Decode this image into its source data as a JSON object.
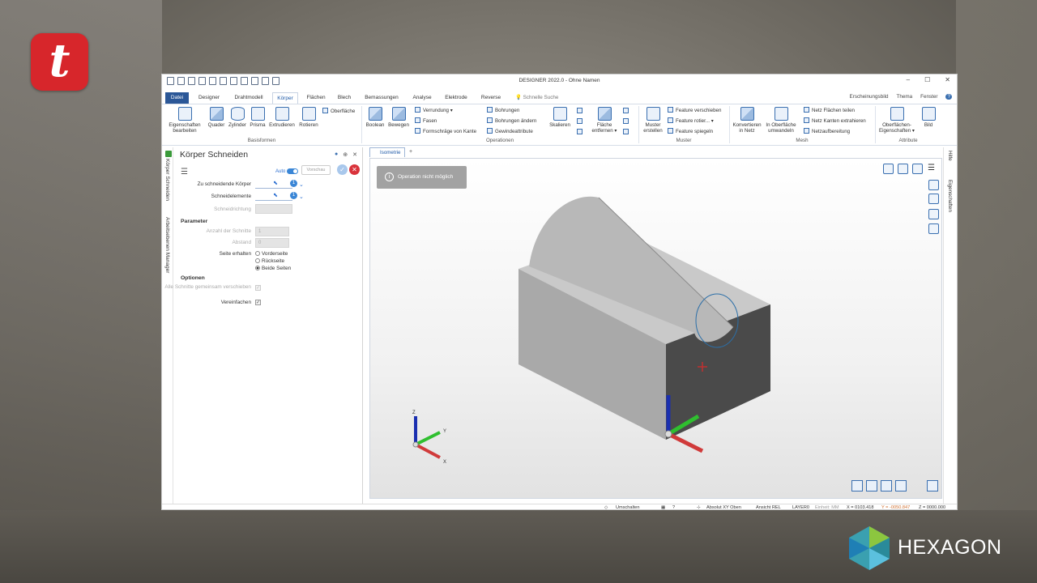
{
  "brand": {
    "corner_logo_letter": "t",
    "vendor_name": "HEXAGON"
  },
  "window": {
    "title": "DESIGNER 2022.0 - Ohne Namen",
    "controls": [
      "–",
      "☐",
      "✕"
    ]
  },
  "tabs": [
    {
      "label": "Datei",
      "kind": "file"
    },
    {
      "label": "Designer"
    },
    {
      "label": "Drahtmodell"
    },
    {
      "label": "Körper",
      "kind": "active"
    },
    {
      "label": "Flächen"
    },
    {
      "label": "Blech"
    },
    {
      "label": "Bemassungen"
    },
    {
      "label": "Analyse"
    },
    {
      "label": "Elektrode"
    },
    {
      "label": "Reverse"
    }
  ],
  "quick_search": "Schnelle Suche",
  "right_links": {
    "appearance": "Erscheinungsbild",
    "theme": "Thema",
    "window": "Fenster",
    "help": "?"
  },
  "ribbon": {
    "basisformen": {
      "label": "Basisformen",
      "buttons": [
        "Eigenschaften bearbeiten",
        "Quader",
        "Zylinder",
        "Prisma",
        "Extrudieren",
        "Rotieren"
      ],
      "small": [
        "Oberfläche"
      ]
    },
    "operationen": {
      "label": "Operationen",
      "buttons": [
        "Boolean",
        "Bewegen",
        "Skalieren",
        "Fläche entfernen"
      ],
      "small_col1": [
        "Verrundung",
        "Fasen",
        "Formschräge von Kante"
      ],
      "small_col2": [
        "Bohrungen",
        "Bohrungen ändern",
        "Gewindeattribute"
      ]
    },
    "muster": {
      "label": "Muster",
      "buttons": [
        "Muster erstellen"
      ],
      "small": [
        "Feature verschieben",
        "Feature rotier...",
        "Feature spiegeln"
      ]
    },
    "mesh": {
      "label": "Mesh",
      "buttons": [
        "Konvertieren in Netz",
        "In Oberfläche umwandeln"
      ],
      "small": [
        "Netz Flächen teilen",
        "Netz Kanten extrahieren",
        "Netzaufbereitung"
      ]
    },
    "attribute": {
      "label": "Attribute",
      "buttons": [
        "Oberflächen-Eigenschaften",
        "Bild"
      ]
    }
  },
  "panel": {
    "title": "Körper Schneiden",
    "side_tabs": [
      "Körper Schneiden",
      "Arbeitsebenen Manager"
    ],
    "auto_label": "Auto",
    "preview_label": "Vorschau",
    "fields": {
      "bodies_label": "Zu schneidende Körper",
      "bodies_count": "1",
      "cut_elements_label": "Schneidelemente",
      "cut_elements_count": "1",
      "direction_label": "Schneidrichtung"
    },
    "parameter_header": "Parameter",
    "params": {
      "count_label": "Anzahl der Schnitte",
      "count_value": "1",
      "distance_label": "Abstand",
      "distance_value": "0",
      "keep_side_label": "Seite erhalten",
      "sides": [
        "Vorderseite",
        "Rückseite",
        "Beide Seiten"
      ],
      "selected_side": "Beide Seiten"
    },
    "options_header": "Optionen",
    "options": {
      "move_all_label": "Alle Schnitte gemeinsam verschieben",
      "simplify_label": "Vereinfachen"
    }
  },
  "viewport": {
    "tab_label": "Isometrie",
    "toast": "Operation nicht möglich",
    "triad_labels": [
      "Z",
      "Y",
      "X"
    ]
  },
  "right_rail": [
    "Hilfe",
    "Eigenschaften"
  ],
  "statusbar": {
    "toggle": "Umschalten",
    "abs": "Absolut XY Oben",
    "view": "Ansicht REL",
    "layer": "LAYER0",
    "unit": "Einheit: MM",
    "x": "X = 0103.418",
    "y": "Y = -0050.847",
    "z": "Z = 0000.000"
  },
  "colors": {
    "brand_red": "#d7262b",
    "ribbon_blue": "#2b5797",
    "cancel_red": "#d9333b"
  }
}
